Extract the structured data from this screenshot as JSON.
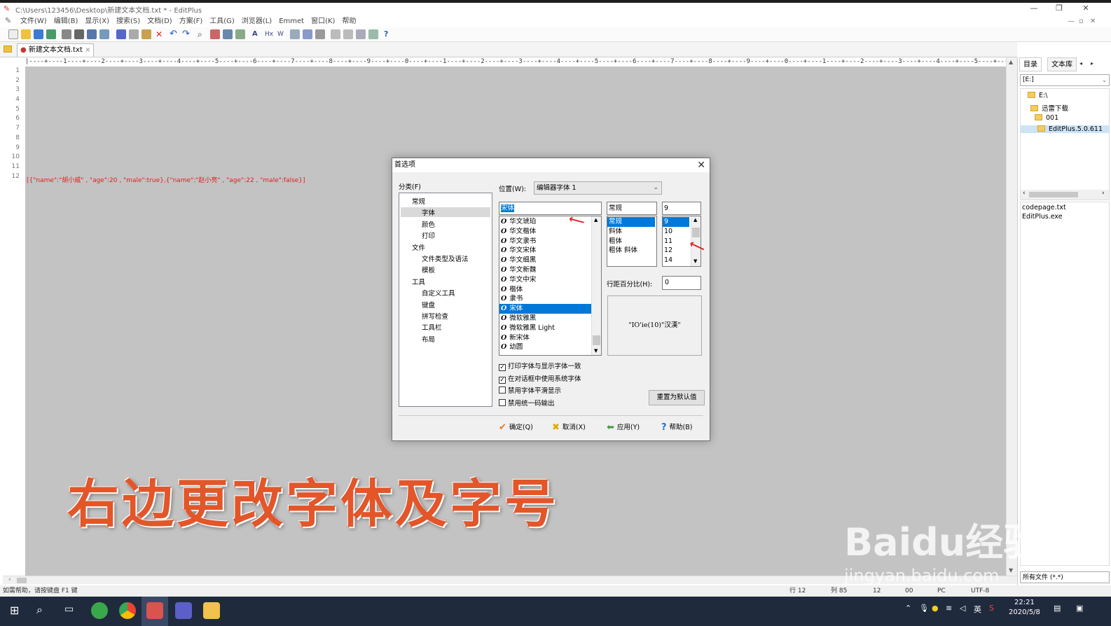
{
  "window": {
    "title": "C:\\Users\\123456\\Desktop\\新建文本文档.txt * - EditPlus",
    "minimize_symbol": "—",
    "restore_symbol": "❐",
    "close_symbol": "✕"
  },
  "menu": [
    "文件(W)",
    "编辑(B)",
    "显示(X)",
    "搜索(S)",
    "文档(D)",
    "方案(F)",
    "工具(G)",
    "浏览器(L)",
    "Emmet",
    "窗口(K)",
    "帮助"
  ],
  "menu_right": {
    "minimize": "—",
    "restore": "▫",
    "close": "✕"
  },
  "tab": {
    "label": "新建文本文档.txt"
  },
  "ruler_text": "|----+----1----+----2----+----3----+----4----+----5----+----6----+----7----+----8----+----9----+----0----+----1----+----2----+----3----+----4----+----5----+----6----+----7----+----8----+----9----+----0----+----1----+----2----+----3----+----4----+----5----+----6----+----7----+----8---",
  "line_numbers": [
    "1",
    "2",
    "3",
    "4",
    "5",
    "6",
    "7",
    "8",
    "9",
    "10",
    "11",
    "12"
  ],
  "code_line": "[{\"name\":\"胡小威\" , \"age\":20 , \"male\":true},{\"name\":\"赵小亮\" , \"age\":22 , \"male\":false}]",
  "side_panel": {
    "tab_dir": "目录",
    "tab_textlib": "文本库",
    "drive": "[E:]",
    "tree": [
      "E:\\",
      "迅雷下载",
      "001",
      "EditPlus.5.0.611"
    ],
    "files": [
      "codepage.txt",
      "EditPlus.exe"
    ],
    "filter": "所有文件 (*.*)"
  },
  "status": {
    "help": "如需帮助，请按键盘 F1 键",
    "row": "行 12",
    "col": "列 85",
    "v1": "12",
    "v2": "00",
    "mode": "PC",
    "encoding": "UTF-8"
  },
  "taskbar": {
    "time": "22:21",
    "date": "2020/5/8",
    "ime": "英"
  },
  "dialog": {
    "title": "首选项",
    "category_label": "分类(F)",
    "categories": [
      {
        "label": "常规",
        "level": 0
      },
      {
        "label": "字体",
        "level": 1,
        "selected": true
      },
      {
        "label": "颜色",
        "level": 1
      },
      {
        "label": "打印",
        "level": 1
      },
      {
        "label": "文件",
        "level": 0
      },
      {
        "label": "文件类型及语法",
        "level": 1
      },
      {
        "label": "模板",
        "level": 1
      },
      {
        "label": "工具",
        "level": 0
      },
      {
        "label": "自定义工具",
        "level": 1
      },
      {
        "label": "键盘",
        "level": 1
      },
      {
        "label": "拼写检查",
        "level": 1
      },
      {
        "label": "工具栏",
        "level": 1
      },
      {
        "label": "布局",
        "level": 1
      }
    ],
    "position_label": "位置(W):",
    "position_value": "编辑器字体 1",
    "font_value": "宋体",
    "fonts": [
      "华文琥珀",
      "华文楷体",
      "华文隶书",
      "华文宋体",
      "华文细黑",
      "华文新魏",
      "华文中宋",
      "楷体",
      "隶书",
      "宋体",
      "微软雅黑",
      "微软雅黑 Light",
      "新宋体",
      "幼圆"
    ],
    "selected_font": "宋体",
    "style_value": "常规",
    "styles": [
      "常规",
      "斜体",
      "粗体",
      "粗体 斜体"
    ],
    "size_value": "9",
    "sizes": [
      "9",
      "10",
      "11",
      "12",
      "14"
    ],
    "spacing_label": "行距百分比(H):",
    "spacing_value": "0",
    "preview": "\"IO'ie(10)\"汉漢\"",
    "checkboxes": [
      {
        "label": "打印字体与显示字体一致",
        "checked": true
      },
      {
        "label": "在对话框中使用系统字体",
        "checked": true
      },
      {
        "label": "禁用字体平滑显示",
        "checked": false
      },
      {
        "label": "禁用统一码输出",
        "checked": false
      }
    ],
    "reset_button": "重置为默认值",
    "ok": "确定(Q)",
    "cancel": "取消(X)",
    "apply": "应用(Y)",
    "help": "帮助(B)"
  },
  "caption": "右边更改字体及字号",
  "watermark": "Baidu经验",
  "watermark_url": "jingyan.baidu.com"
}
